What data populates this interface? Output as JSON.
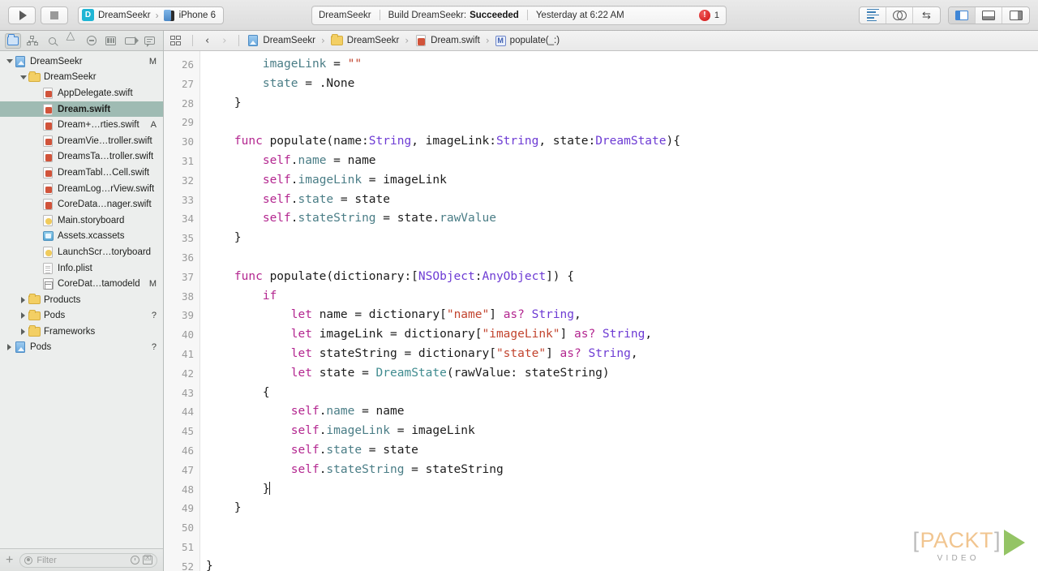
{
  "toolbar": {
    "run_button": "run",
    "stop_button": "stop",
    "scheme_badge": "D",
    "scheme_name": "DreamSeekr",
    "scheme_separator": "›",
    "destination": "iPhone 6",
    "status": {
      "project": "DreamSeekr",
      "divider": "|",
      "build_prefix": "Build DreamSeekr:",
      "build_result": "Succeeded",
      "timestamp": "Yesterday at 6:22 AM",
      "error_glyph": "!",
      "error_count": "1"
    },
    "editor_modes": [
      "standard-editor",
      "assistant-editor",
      "version-editor"
    ],
    "view_toggles": [
      "navigator-toggle",
      "debug-area-toggle",
      "utilities-toggle"
    ],
    "accent_blue": "#3f86d6",
    "error_red": "#cf1111"
  },
  "navigator": {
    "tabs": [
      "project-navigator",
      "symbol-navigator",
      "find-navigator",
      "issue-navigator",
      "test-navigator",
      "debug-navigator",
      "breakpoint-navigator",
      "report-navigator"
    ],
    "selected_tab": "project-navigator",
    "tree": [
      {
        "label": "DreamSeekr",
        "indent": 0,
        "twisty": "down",
        "icon": "project-icon",
        "badge": "M",
        "selected": false
      },
      {
        "label": "DreamSeekr",
        "indent": 1,
        "twisty": "down",
        "icon": "folder-icon",
        "badge": "",
        "selected": false
      },
      {
        "label": "AppDelegate.swift",
        "indent": 2,
        "twisty": "none",
        "icon": "swift-icon",
        "badge": "",
        "selected": false
      },
      {
        "label": "Dream.swift",
        "indent": 2,
        "twisty": "none",
        "icon": "swift-icon",
        "badge": "",
        "selected": true
      },
      {
        "label": "Dream+…rties.swift",
        "indent": 2,
        "twisty": "none",
        "icon": "swift-icon",
        "badge": "A",
        "selected": false
      },
      {
        "label": "DreamVie…troller.swift",
        "indent": 2,
        "twisty": "none",
        "icon": "swift-icon",
        "badge": "",
        "selected": false
      },
      {
        "label": "DreamsTa…troller.swift",
        "indent": 2,
        "twisty": "none",
        "icon": "swift-icon",
        "badge": "",
        "selected": false
      },
      {
        "label": "DreamTabl…Cell.swift",
        "indent": 2,
        "twisty": "none",
        "icon": "swift-icon",
        "badge": "",
        "selected": false
      },
      {
        "label": "DreamLog…rView.swift",
        "indent": 2,
        "twisty": "none",
        "icon": "swift-icon",
        "badge": "",
        "selected": false
      },
      {
        "label": "CoreData…nager.swift",
        "indent": 2,
        "twisty": "none",
        "icon": "swift-icon",
        "badge": "",
        "selected": false
      },
      {
        "label": "Main.storyboard",
        "indent": 2,
        "twisty": "none",
        "icon": "storyboard-icon",
        "badge": "",
        "selected": false
      },
      {
        "label": "Assets.xcassets",
        "indent": 2,
        "twisty": "none",
        "icon": "assets-icon",
        "badge": "",
        "selected": false
      },
      {
        "label": "LaunchScr…toryboard",
        "indent": 2,
        "twisty": "none",
        "icon": "storyboard-icon",
        "badge": "",
        "selected": false
      },
      {
        "label": "Info.plist",
        "indent": 2,
        "twisty": "none",
        "icon": "plist-icon",
        "badge": "",
        "selected": false
      },
      {
        "label": "CoreDat…tamodeld",
        "indent": 2,
        "twisty": "none",
        "icon": "xcdatamodel-icon",
        "badge": "M",
        "selected": false
      },
      {
        "label": "Products",
        "indent": 1,
        "twisty": "right",
        "icon": "folder-icon",
        "badge": "",
        "selected": false
      },
      {
        "label": "Pods",
        "indent": 1,
        "twisty": "right",
        "icon": "folder-icon",
        "badge": "?",
        "selected": false
      },
      {
        "label": "Frameworks",
        "indent": 1,
        "twisty": "right",
        "icon": "folder-icon",
        "badge": "",
        "selected": false
      },
      {
        "label": "Pods",
        "indent": 0,
        "twisty": "right",
        "icon": "project-icon",
        "badge": "?",
        "selected": false
      }
    ],
    "add_button": "+",
    "filter_placeholder": "Filter",
    "filter_value": "",
    "selection_color": "#9fbbb3"
  },
  "jumpbar": {
    "related_items": "related-items",
    "back": "‹",
    "forward": "›",
    "separator": "›",
    "crumbs": [
      {
        "label": "DreamSeekr",
        "icon": "project-icon"
      },
      {
        "label": "DreamSeekr",
        "icon": "folder-icon"
      },
      {
        "label": "Dream.swift",
        "icon": "swift-icon"
      },
      {
        "label": "populate(_:)",
        "icon": "method-icon",
        "badge": "M"
      }
    ]
  },
  "editor": {
    "first_line": 26,
    "caret_line": 48,
    "lines": [
      {
        "n": 26,
        "tokens": [
          {
            "t": "        ",
            "c": "pn"
          },
          {
            "t": "imageLink",
            "c": "prop"
          },
          {
            "t": " = ",
            "c": "pn"
          },
          {
            "t": "\"\"",
            "c": "str"
          }
        ]
      },
      {
        "n": 27,
        "tokens": [
          {
            "t": "        ",
            "c": "pn"
          },
          {
            "t": "state",
            "c": "prop"
          },
          {
            "t": " = .None",
            "c": "pn"
          }
        ]
      },
      {
        "n": 28,
        "tokens": [
          {
            "t": "    }",
            "c": "pn"
          }
        ]
      },
      {
        "n": 29,
        "tokens": []
      },
      {
        "n": 30,
        "tokens": [
          {
            "t": "    ",
            "c": "pn"
          },
          {
            "t": "func",
            "c": "kw"
          },
          {
            "t": " populate(name:",
            "c": "pn"
          },
          {
            "t": "String",
            "c": "ty"
          },
          {
            "t": ", imageLink:",
            "c": "pn"
          },
          {
            "t": "String",
            "c": "ty"
          },
          {
            "t": ", state:",
            "c": "pn"
          },
          {
            "t": "DreamState",
            "c": "ty"
          },
          {
            "t": "){",
            "c": "pn"
          }
        ]
      },
      {
        "n": 31,
        "tokens": [
          {
            "t": "        ",
            "c": "pn"
          },
          {
            "t": "self",
            "c": "kw"
          },
          {
            "t": ".",
            "c": "pn"
          },
          {
            "t": "name",
            "c": "prop"
          },
          {
            "t": " = name",
            "c": "pn"
          }
        ]
      },
      {
        "n": 32,
        "tokens": [
          {
            "t": "        ",
            "c": "pn"
          },
          {
            "t": "self",
            "c": "kw"
          },
          {
            "t": ".",
            "c": "pn"
          },
          {
            "t": "imageLink",
            "c": "prop"
          },
          {
            "t": " = imageLink",
            "c": "pn"
          }
        ]
      },
      {
        "n": 33,
        "tokens": [
          {
            "t": "        ",
            "c": "pn"
          },
          {
            "t": "self",
            "c": "kw"
          },
          {
            "t": ".",
            "c": "pn"
          },
          {
            "t": "state",
            "c": "prop"
          },
          {
            "t": " = state",
            "c": "pn"
          }
        ]
      },
      {
        "n": 34,
        "tokens": [
          {
            "t": "        ",
            "c": "pn"
          },
          {
            "t": "self",
            "c": "kw"
          },
          {
            "t": ".",
            "c": "pn"
          },
          {
            "t": "stateString",
            "c": "prop"
          },
          {
            "t": " = state.",
            "c": "pn"
          },
          {
            "t": "rawValue",
            "c": "prop"
          }
        ]
      },
      {
        "n": 35,
        "tokens": [
          {
            "t": "    }",
            "c": "pn"
          }
        ]
      },
      {
        "n": 36,
        "tokens": []
      },
      {
        "n": 37,
        "tokens": [
          {
            "t": "    ",
            "c": "pn"
          },
          {
            "t": "func",
            "c": "kw"
          },
          {
            "t": " populate(dictionary:[",
            "c": "pn"
          },
          {
            "t": "NSObject",
            "c": "ty"
          },
          {
            "t": ":",
            "c": "pn"
          },
          {
            "t": "AnyObject",
            "c": "ty"
          },
          {
            "t": "]) {",
            "c": "pn"
          }
        ]
      },
      {
        "n": 38,
        "tokens": [
          {
            "t": "        ",
            "c": "pn"
          },
          {
            "t": "if",
            "c": "kw"
          }
        ]
      },
      {
        "n": 39,
        "tokens": [
          {
            "t": "            ",
            "c": "pn"
          },
          {
            "t": "let",
            "c": "kw"
          },
          {
            "t": " name = dictionary[",
            "c": "pn"
          },
          {
            "t": "\"name\"",
            "c": "str"
          },
          {
            "t": "] ",
            "c": "pn"
          },
          {
            "t": "as?",
            "c": "kw"
          },
          {
            "t": " ",
            "c": "pn"
          },
          {
            "t": "String",
            "c": "ty"
          },
          {
            "t": ",",
            "c": "pn"
          }
        ]
      },
      {
        "n": 40,
        "tokens": [
          {
            "t": "            ",
            "c": "pn"
          },
          {
            "t": "let",
            "c": "kw"
          },
          {
            "t": " imageLink = dictionary[",
            "c": "pn"
          },
          {
            "t": "\"imageLink\"",
            "c": "str"
          },
          {
            "t": "] ",
            "c": "pn"
          },
          {
            "t": "as?",
            "c": "kw"
          },
          {
            "t": " ",
            "c": "pn"
          },
          {
            "t": "String",
            "c": "ty"
          },
          {
            "t": ",",
            "c": "pn"
          }
        ]
      },
      {
        "n": 41,
        "tokens": [
          {
            "t": "            ",
            "c": "pn"
          },
          {
            "t": "let",
            "c": "kw"
          },
          {
            "t": " stateString = dictionary[",
            "c": "pn"
          },
          {
            "t": "\"state\"",
            "c": "str"
          },
          {
            "t": "] ",
            "c": "pn"
          },
          {
            "t": "as?",
            "c": "kw"
          },
          {
            "t": " ",
            "c": "pn"
          },
          {
            "t": "String",
            "c": "ty"
          },
          {
            "t": ",",
            "c": "pn"
          }
        ]
      },
      {
        "n": 42,
        "tokens": [
          {
            "t": "            ",
            "c": "pn"
          },
          {
            "t": "let",
            "c": "kw"
          },
          {
            "t": " state = ",
            "c": "pn"
          },
          {
            "t": "DreamState",
            "c": "pty"
          },
          {
            "t": "(rawValue: stateString)",
            "c": "pn"
          }
        ]
      },
      {
        "n": 43,
        "tokens": [
          {
            "t": "        {",
            "c": "pn"
          }
        ]
      },
      {
        "n": 44,
        "tokens": [
          {
            "t": "            ",
            "c": "pn"
          },
          {
            "t": "self",
            "c": "kw"
          },
          {
            "t": ".",
            "c": "pn"
          },
          {
            "t": "name",
            "c": "prop"
          },
          {
            "t": " = name",
            "c": "pn"
          }
        ]
      },
      {
        "n": 45,
        "tokens": [
          {
            "t": "            ",
            "c": "pn"
          },
          {
            "t": "self",
            "c": "kw"
          },
          {
            "t": ".",
            "c": "pn"
          },
          {
            "t": "imageLink",
            "c": "prop"
          },
          {
            "t": " = imageLink",
            "c": "pn"
          }
        ]
      },
      {
        "n": 46,
        "tokens": [
          {
            "t": "            ",
            "c": "pn"
          },
          {
            "t": "self",
            "c": "kw"
          },
          {
            "t": ".",
            "c": "pn"
          },
          {
            "t": "state",
            "c": "prop"
          },
          {
            "t": " = state",
            "c": "pn"
          }
        ]
      },
      {
        "n": 47,
        "tokens": [
          {
            "t": "            ",
            "c": "pn"
          },
          {
            "t": "self",
            "c": "kw"
          },
          {
            "t": ".",
            "c": "pn"
          },
          {
            "t": "stateString",
            "c": "prop"
          },
          {
            "t": " = stateString",
            "c": "pn"
          }
        ]
      },
      {
        "n": 48,
        "tokens": [
          {
            "t": "        }",
            "c": "pn"
          }
        ],
        "caret": true
      },
      {
        "n": 49,
        "tokens": [
          {
            "t": "    }",
            "c": "pn"
          }
        ]
      },
      {
        "n": 50,
        "tokens": []
      },
      {
        "n": 51,
        "tokens": []
      },
      {
        "n": 52,
        "tokens": [
          {
            "t": "}",
            "c": "pn"
          }
        ]
      }
    ]
  },
  "watermark": {
    "bracket_left": "[",
    "brand": "PACKT",
    "bracket_right": "]",
    "subtitle": "VIDEO",
    "brand_color": "#f0c187",
    "triangle_color": "#8cbf58"
  }
}
